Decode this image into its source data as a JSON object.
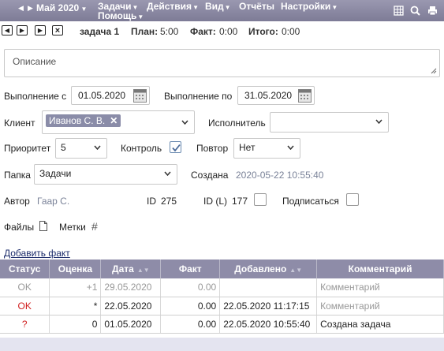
{
  "topbar": {
    "month": "Май 2020",
    "menus": [
      "Задачи",
      "Действия",
      "Вид",
      "Отчёты",
      "Настройки",
      "Помощь"
    ],
    "icons": [
      "grid-icon",
      "search-icon",
      "print-icon"
    ]
  },
  "task": {
    "name": "задача 1",
    "plan_label": "План:",
    "plan": "5:00",
    "fact_label": "Факт:",
    "fact": "0:00",
    "total_label": "Итого:",
    "total": "0:00"
  },
  "form": {
    "description_placeholder": "Описание",
    "exec_from_label": "Выполнение с",
    "exec_from": "01.05.2020",
    "exec_to_label": "Выполнение по",
    "exec_to": "31.05.2020",
    "client_label": "Клиент",
    "client_chip": "Иванов С. В.",
    "executor_label": "Исполнитель",
    "executor": "",
    "priority_label": "Приоритет",
    "priority": "5",
    "control_label": "Контроль",
    "control_checked": true,
    "repeat_label": "Повтор",
    "repeat": "Нет",
    "folder_label": "Папка",
    "folder": "Задачи",
    "created_label": "Создана",
    "created": "2020-05-22 10:55:40",
    "author_label": "Автор",
    "author": "Гаар С.",
    "id_label": "ID",
    "id": "275",
    "idl_label": "ID (L)",
    "idl": "177",
    "subscribe_label": "Подписаться",
    "files_label": "Файлы",
    "tags_label": "Метки",
    "add_fact": "Добавить факт"
  },
  "table": {
    "headers": [
      "Статус",
      "Оценка",
      "Дата",
      "Факт",
      "Добавлено",
      "Комментарий"
    ],
    "rows": [
      {
        "status": "OK",
        "score": "+1",
        "date": "29.05.2020",
        "fact": "0.00",
        "added": "",
        "comment": "Комментарий"
      },
      {
        "status": "OK",
        "score": "*",
        "date": "22.05.2020",
        "fact": "0.00",
        "added": "22.05.2020 11:17:15",
        "comment": "Комментарий"
      },
      {
        "status": "?",
        "score": "0",
        "date": "01.05.2020",
        "fact": "0.00",
        "added": "22.05.2020 10:55:40",
        "comment": "Создана задача"
      }
    ]
  }
}
